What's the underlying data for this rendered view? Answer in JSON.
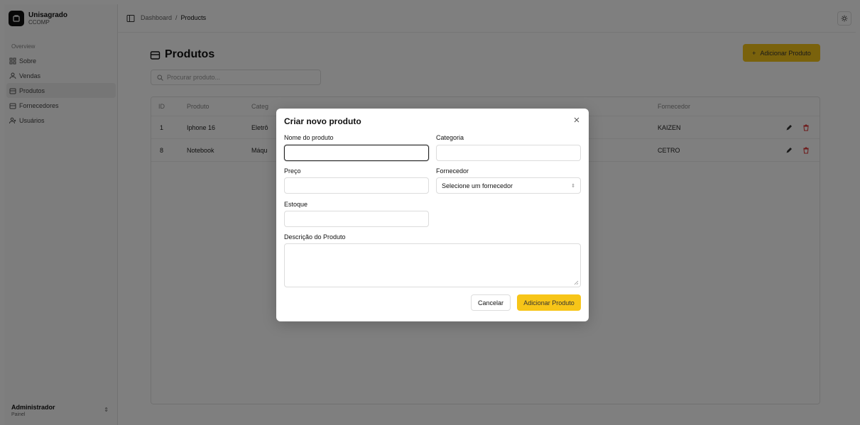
{
  "brand": {
    "name": "Unisagrado",
    "subtitle": "CCOMP"
  },
  "sidebar": {
    "group_label": "Overview",
    "items": [
      {
        "label": "Sobre",
        "icon": "grid-icon",
        "active": false
      },
      {
        "label": "Vendas",
        "icon": "user-icon",
        "active": false
      },
      {
        "label": "Produtos",
        "icon": "box-icon",
        "active": true
      },
      {
        "label": "Fornecedores",
        "icon": "box-icon",
        "active": false
      },
      {
        "label": "Usuários",
        "icon": "users-icon",
        "active": false
      }
    ],
    "user": {
      "name": "Administrador",
      "role": "Painel"
    }
  },
  "header": {
    "breadcrumb": [
      "Dashboard",
      "Products"
    ]
  },
  "main": {
    "title": "Produtos",
    "add_button": "Adicionar Produto",
    "search_placeholder": "Procurar produto...",
    "table": {
      "columns": [
        "ID",
        "Produto",
        "Categ",
        "Fornecedor"
      ],
      "rows": [
        {
          "id": "1",
          "produto": "Iphone 16",
          "categoria": "Eletrô",
          "fornecedor": "KAIZEN"
        },
        {
          "id": "8",
          "produto": "Notebook",
          "categoria": "Máqu",
          "fornecedor": "CETRO"
        }
      ]
    }
  },
  "dialog": {
    "title": "Criar novo produto",
    "fields": {
      "nome": {
        "label": "Nome do produto",
        "value": ""
      },
      "categoria": {
        "label": "Categoria",
        "value": ""
      },
      "preco": {
        "label": "Preço",
        "value": ""
      },
      "fornecedor": {
        "label": "Fornecedor",
        "value": "Selecione um fornecedor"
      },
      "estoque": {
        "label": "Estoque",
        "value": ""
      },
      "descricao": {
        "label": "Descrição do Produto",
        "value": ""
      }
    },
    "cancel_label": "Cancelar",
    "submit_label": "Adicionar Produto"
  },
  "colors": {
    "accent": "#f7c518",
    "overlay": "#000000"
  }
}
